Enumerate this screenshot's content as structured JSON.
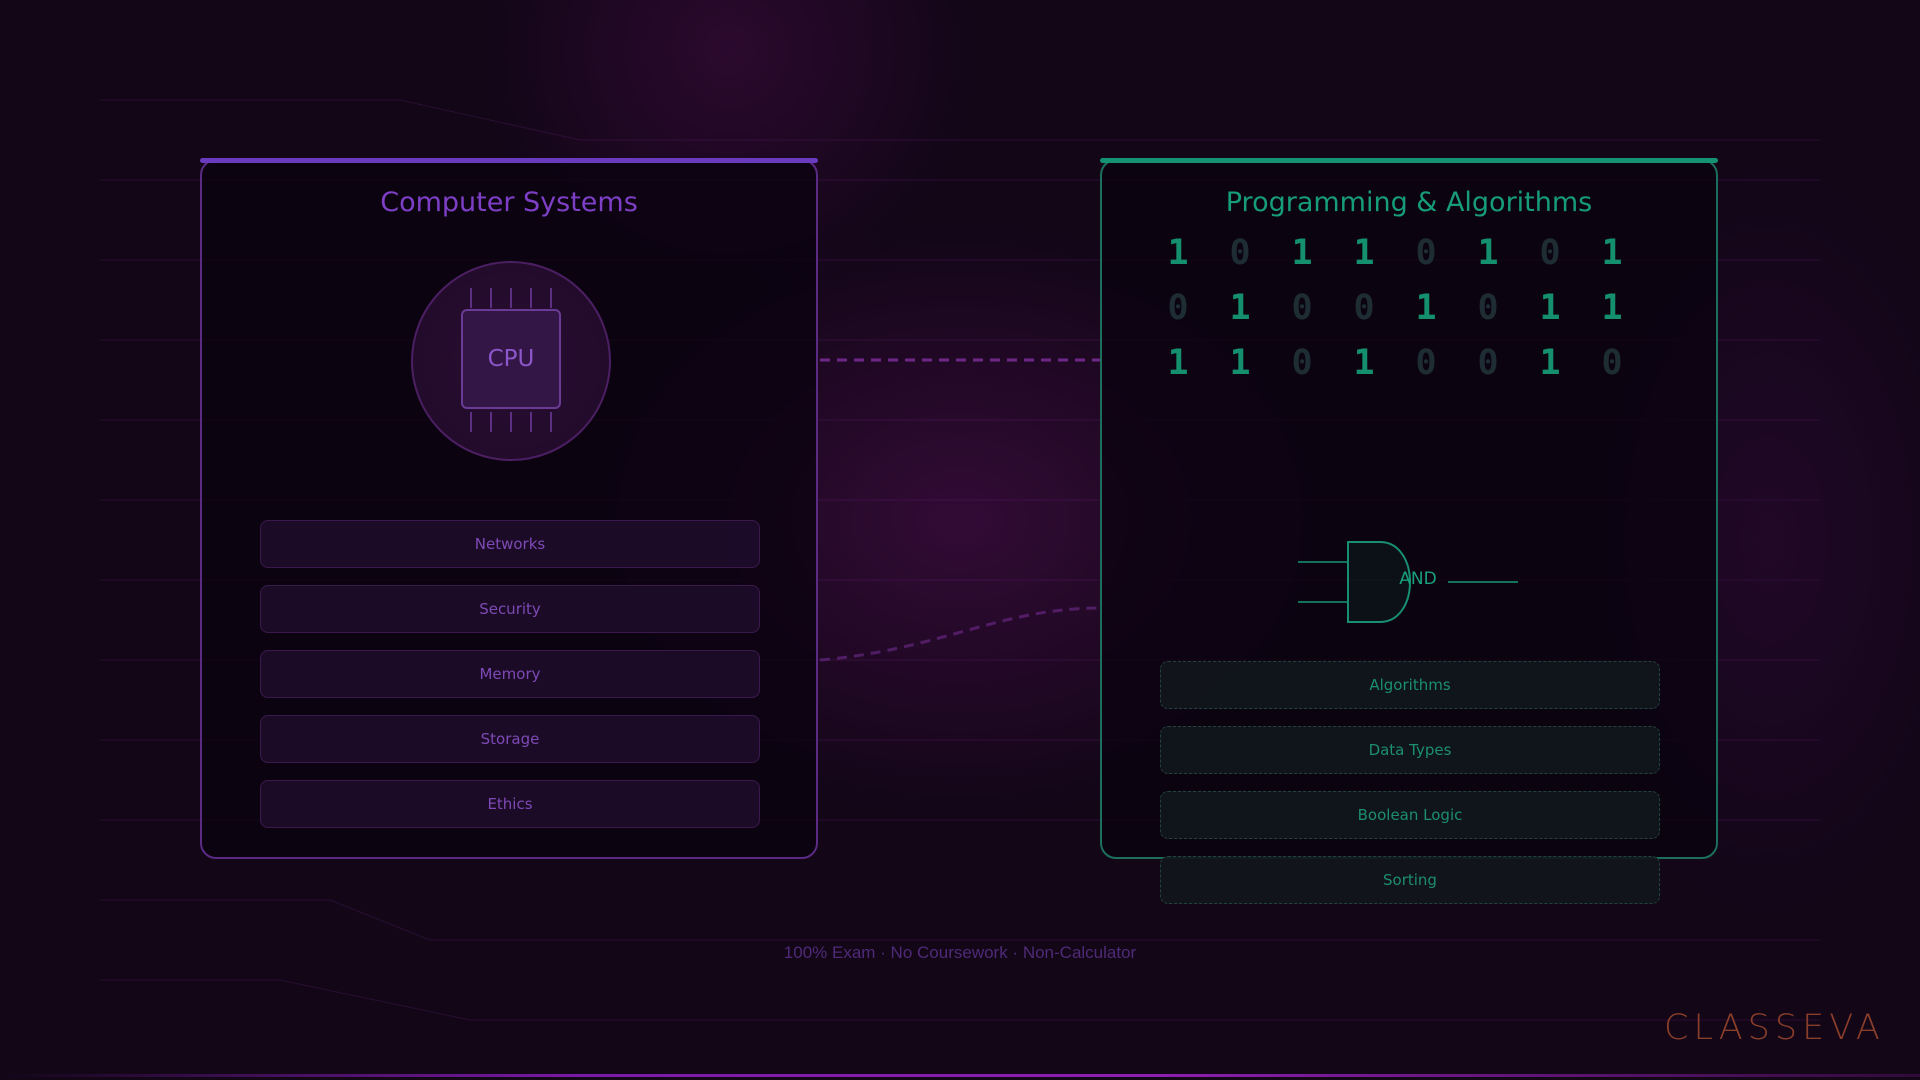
{
  "left_panel": {
    "title": "Computer Systems",
    "chip_label": "CPU",
    "items": [
      "Networks",
      "Security",
      "Memory",
      "Storage",
      "Ethics"
    ],
    "accent": "#7d3fc6"
  },
  "right_panel": {
    "title": "Programming & Algorithms",
    "binary_rows": [
      [
        "1",
        "0",
        "1",
        "1",
        "0",
        "1",
        "0",
        "1"
      ],
      [
        "0",
        "1",
        "0",
        "0",
        "1",
        "0",
        "1",
        "1"
      ],
      [
        "1",
        "1",
        "0",
        "1",
        "0",
        "0",
        "1",
        "0"
      ]
    ],
    "gate_label": "AND",
    "items": [
      "Algorithms",
      "Data Types",
      "Boolean Logic",
      "Sorting"
    ],
    "accent": "#169c7b"
  },
  "footer": {
    "text": "100% Exam · No Coursework · Non-Calculator"
  },
  "brand": {
    "logo_text": "CLASSEVA",
    "color": "#8a3e2a"
  },
  "colors": {
    "background": "#120617",
    "connector": "#6e2a8c"
  }
}
